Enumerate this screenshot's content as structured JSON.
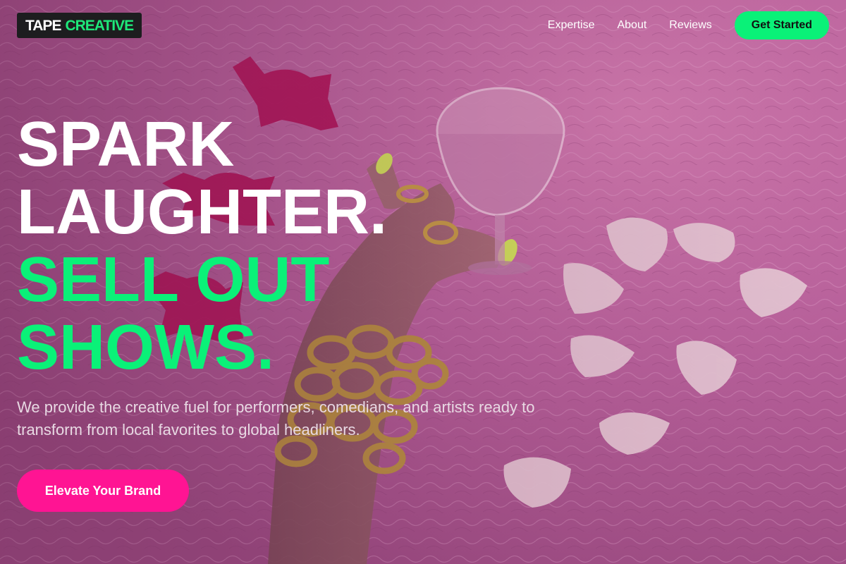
{
  "brand": {
    "logo_word1": "TAPE",
    "logo_word2": "CREATIVE",
    "green": "#0af178",
    "pink": "#ff1493"
  },
  "nav": {
    "links": [
      "Expertise",
      "About",
      "Reviews"
    ],
    "cta_label": "Get Started"
  },
  "hero": {
    "headline_white": [
      "SPARK",
      "LAUGHTER."
    ],
    "headline_green": [
      "SELL OUT",
      "SHOWS."
    ],
    "subtext": "We provide the creative fuel for performers, comedians, and artists ready to transform from local favorites to global headliners.",
    "cta_label": "Elevate Your Brand"
  }
}
